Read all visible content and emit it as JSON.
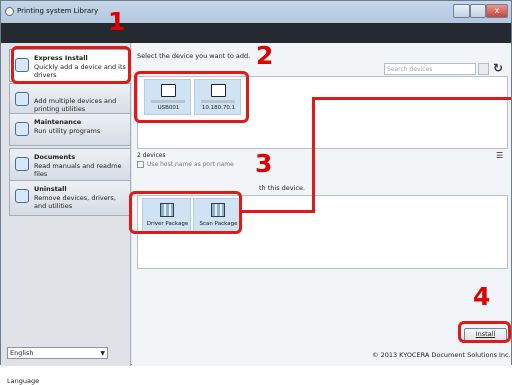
{
  "window": {
    "title": "Printing system Library",
    "close_glyph": "x"
  },
  "sidebar": {
    "items": [
      {
        "title": "Express Install",
        "desc": "Quickly add a device and its drivers",
        "icon": "express-install-icon"
      },
      {
        "title": "",
        "desc": "Add multiple devices and printing utilities",
        "icon": "custom-install-icon"
      },
      {
        "title": "Maintenance",
        "desc": "Run utility programs",
        "icon": "maintenance-icon"
      },
      {
        "title": "Documents",
        "desc": "Read manuals and readme files",
        "icon": "documents-icon"
      },
      {
        "title": "Uninstall",
        "desc": "Remove devices, drivers, and utilities",
        "icon": "uninstall-icon"
      }
    ],
    "language_label": "Language",
    "language_value": "English"
  },
  "main": {
    "prompt": "Select the device you want to add.",
    "search_placeholder": "Search devices",
    "devices": [
      {
        "name": "USB001"
      },
      {
        "name": "10.180.70.1"
      }
    ],
    "device_count": "2 devices",
    "host_checkbox_label": "Use host name as port name",
    "package_text": "th this device.",
    "packages": [
      {
        "name": "Driver Package"
      },
      {
        "name": "Scan Package"
      }
    ],
    "install_label": "Install",
    "copyright": "© 2013 KYOCERA Document Solutions Inc."
  },
  "callouts": [
    "1",
    "2",
    "3",
    "4"
  ],
  "colors": {
    "callout": "#e01a1a",
    "selection": "#cfe3f5",
    "darkbar": "#252a30"
  }
}
